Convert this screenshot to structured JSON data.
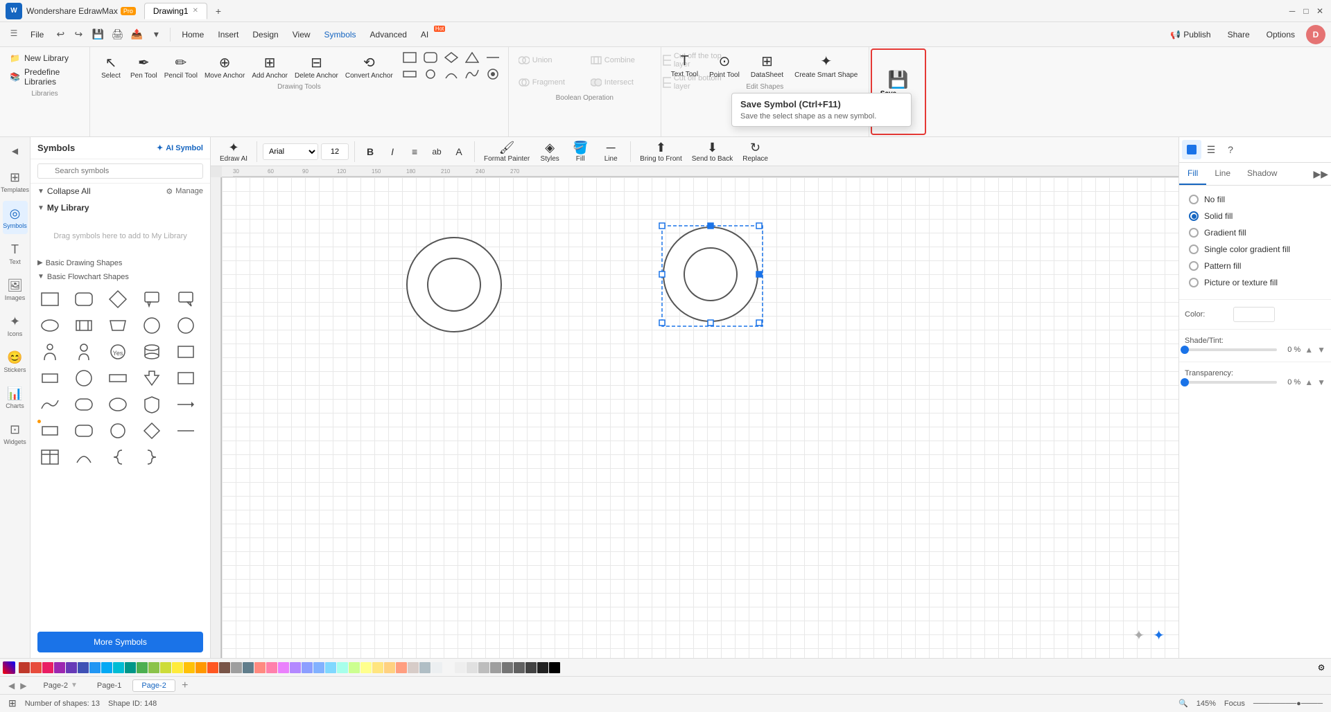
{
  "app": {
    "name": "Wondershare EdrawMax",
    "badge": "Pro",
    "window_title": "Drawing1",
    "tab_add": "+"
  },
  "menu": {
    "items": [
      "File",
      "Home",
      "Insert",
      "Design",
      "View",
      "Symbols",
      "Advanced",
      "AI"
    ],
    "active": "Symbols",
    "ai_badge": "Hot"
  },
  "ribbon": {
    "libraries_group": {
      "label": "Libraries",
      "new_library": "New Library",
      "predefine": "Predefine Libraries"
    },
    "select_label": "Select",
    "pen_tool": "Pen Tool",
    "pencil_tool": "Pencil Tool",
    "move_anchor": "Move Anchor",
    "add_anchor": "Add Anchor",
    "delete_anchor": "Delete Anchor",
    "convert_anchor": "Convert Anchor",
    "drawing_tools_label": "Drawing Tools",
    "shapes_row": [
      "rect",
      "rect-rounded",
      "diamond",
      "parallelogram",
      "trapezoid",
      "square",
      "circle",
      "arc",
      "line"
    ],
    "boolean": {
      "label": "Boolean Operation",
      "union": "Union",
      "combine": "Combine",
      "fragment": "Fragment",
      "intersect": "Intersect",
      "cut_top": "Cut off the top layer",
      "cut_bottom": "Cut off bottom layer"
    },
    "edit_shapes": {
      "label": "Edit Shapes",
      "text_tool": "Text Tool",
      "point_tool": "Point Tool",
      "data_sheet": "DataSheet",
      "create_smart": "Create Smart Shape"
    },
    "save_symbol": {
      "label": "Save",
      "title": "Save Symbol",
      "shortcut": "Ctrl+F11",
      "tooltip_title": "Save Symbol (Ctrl+F11)",
      "tooltip_desc": "Save the select shape as a new symbol."
    },
    "save_group_label": "Save"
  },
  "secondary_toolbar": {
    "edraw_ai": "Edraw AI",
    "font_name": "Arial",
    "font_size": "12",
    "bold": "B",
    "italic": "I",
    "align": "≡",
    "format_painter": "Format Painter",
    "styles": "Styles",
    "fill": "Fill",
    "line": "Line",
    "bring_to_front": "Bring to Front",
    "send_to_back": "Send to Back",
    "replace": "Replace"
  },
  "symbols_panel": {
    "title": "Symbols",
    "ai_symbol_btn": "AI Symbol",
    "search_placeholder": "Search symbols",
    "collapse_all": "Collapse All",
    "manage": "Manage",
    "my_library": "My Library",
    "my_library_empty": "Drag symbols here to add to My Library",
    "basic_drawing_shapes": "Basic Drawing Shapes",
    "basic_flowchart_shapes": "Basic Flowchart Shapes",
    "more_symbols": "More Symbols"
  },
  "right_panel": {
    "tabs": [
      "Fill",
      "Line",
      "Shadow"
    ],
    "active_tab": "Fill",
    "fill_options": [
      {
        "id": "no_fill",
        "label": "No fill",
        "selected": false
      },
      {
        "id": "solid_fill",
        "label": "Solid fill",
        "selected": true
      },
      {
        "id": "gradient_fill",
        "label": "Gradient fill",
        "selected": false
      },
      {
        "id": "single_color_gradient",
        "label": "Single color gradient fill",
        "selected": false
      },
      {
        "id": "pattern_fill",
        "label": "Pattern fill",
        "selected": false
      },
      {
        "id": "picture_fill",
        "label": "Picture or texture fill",
        "selected": false
      }
    ],
    "color_label": "Color:",
    "shade_tint_label": "Shade/Tint:",
    "shade_value": "0 %",
    "transparency_label": "Transparency:",
    "transparency_value": "0 %"
  },
  "nav_items": [
    {
      "id": "templates",
      "label": "Templates",
      "icon": "⊞"
    },
    {
      "id": "symbols",
      "label": "Symbols",
      "icon": "◎",
      "active": true
    },
    {
      "id": "text",
      "label": "Text",
      "icon": "T"
    },
    {
      "id": "images",
      "label": "Images",
      "icon": "🖼"
    },
    {
      "id": "icons",
      "label": "Icons",
      "icon": "✦"
    },
    {
      "id": "stickers",
      "label": "Stickers",
      "icon": "😊"
    },
    {
      "id": "charts",
      "label": "Charts",
      "icon": "📊"
    },
    {
      "id": "widgets",
      "label": "Widgets",
      "icon": "⊡"
    }
  ],
  "status_bar": {
    "shapes_count": "Number of shapes: 13",
    "shape_id": "Shape ID: 148",
    "focus": "Focus",
    "zoom": "145%"
  },
  "page_tabs": [
    {
      "id": "page2_top",
      "label": "Page-2",
      "active": false
    },
    {
      "id": "page1",
      "label": "Page-1",
      "active": false
    },
    {
      "id": "page2",
      "label": "Page-2",
      "active": true
    }
  ],
  "colors": {
    "accent_blue": "#1a73e8",
    "save_border": "#e53935",
    "selected_handle": "#1a73e8"
  },
  "palette": [
    "#c0392b",
    "#e74c3c",
    "#e91e63",
    "#9c27b0",
    "#673ab7",
    "#3f51b5",
    "#2196f3",
    "#03a9f4",
    "#00bcd4",
    "#009688",
    "#4caf50",
    "#8bc34a",
    "#cddc39",
    "#ffeb3b",
    "#ffc107",
    "#ff9800",
    "#ff5722",
    "#795548",
    "#9e9e9e",
    "#607d8b",
    "#ffffff",
    "#f5f5f5",
    "#eeeeee",
    "#e0e0e0",
    "#bdbdbd",
    "#9e9e9e",
    "#757575",
    "#616161",
    "#424242",
    "#212121",
    "#000000"
  ]
}
